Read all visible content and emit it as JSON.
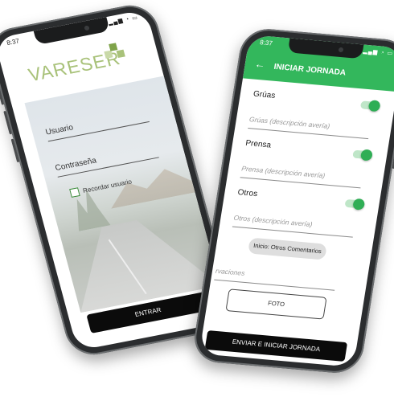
{
  "login": {
    "status_time": "8:37",
    "logo_text": "VARESER",
    "username_label": "Usuario",
    "password_label": "Contraseña",
    "remember_label": "Recordar usuario",
    "enter_button": "ENTRAR",
    "accent": "#a9c27a"
  },
  "jornada": {
    "status_time": "8:37",
    "title": "INICIAR JORNADA",
    "back_icon": "arrow-left-icon",
    "sections": [
      {
        "label": "Grúas",
        "placeholder": "Grúas (descripción avería)",
        "toggle": true
      },
      {
        "label": "Prensa",
        "placeholder": "Prensa (descripción avería)",
        "toggle": true
      },
      {
        "label": "Otros",
        "placeholder": "Otros (descripción avería)",
        "toggle": true
      }
    ],
    "chip_label": "Inicio: Otros Comentarios",
    "observations_placeholder": "rvaciones",
    "photo_button": "FOTO",
    "submit_button": "ENVIAR E INICIAR JORNADA",
    "accent": "#33b75c"
  }
}
